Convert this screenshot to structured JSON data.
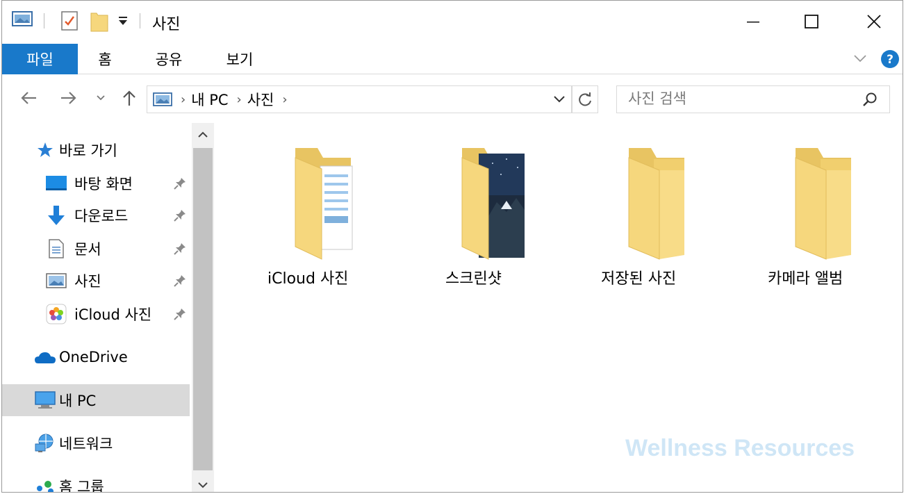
{
  "window": {
    "title": "사진",
    "controls": [
      "minimize",
      "maximize",
      "close"
    ]
  },
  "ribbon": {
    "tabs": [
      {
        "label": "파일",
        "active": true
      },
      {
        "label": "홈",
        "active": false
      },
      {
        "label": "공유",
        "active": false
      },
      {
        "label": "보기",
        "active": false
      }
    ]
  },
  "address": {
    "crumbs": [
      "내 PC",
      "사진"
    ],
    "separator": "›"
  },
  "search": {
    "placeholder": "사진 검색"
  },
  "sidebar": {
    "quick_access": "바로 가기",
    "items": [
      {
        "label": "바탕 화면",
        "icon": "desktop-icon",
        "pinned": true
      },
      {
        "label": "다운로드",
        "icon": "download-icon",
        "pinned": true
      },
      {
        "label": "문서",
        "icon": "document-icon",
        "pinned": true
      },
      {
        "label": "사진",
        "icon": "pictures-icon",
        "pinned": true
      },
      {
        "label": "iCloud 사진",
        "icon": "icloud-photos-icon",
        "pinned": true
      }
    ],
    "onedrive": "OneDrive",
    "this_pc": "내 PC",
    "network": "네트워크",
    "homegroup": "홈 그룹"
  },
  "folders": [
    {
      "name": "iCloud 사진",
      "icon": "folder-with-document-icon"
    },
    {
      "name": "스크린샷",
      "icon": "folder-with-image-icon"
    },
    {
      "name": "저장된 사진",
      "icon": "folder-icon"
    },
    {
      "name": "카메라 앨범",
      "icon": "folder-icon"
    }
  ],
  "watermark": "Wellness Resources",
  "colors": {
    "accent": "#1979ca",
    "folder": "#f6d77d",
    "folder_dark": "#e6bf5a",
    "selection": "#d9d9d9",
    "watermark": "#cfe6f6"
  }
}
